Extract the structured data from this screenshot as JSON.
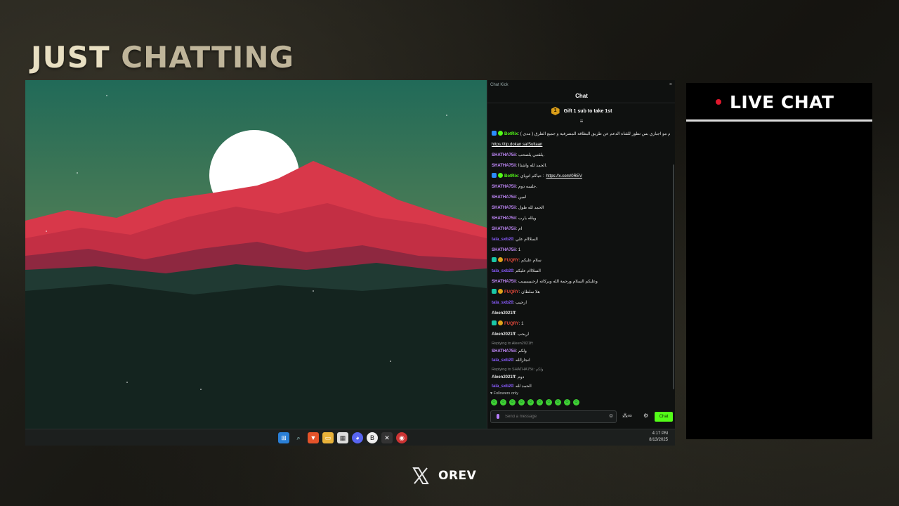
{
  "overlay": {
    "title_word1": "JUST",
    "title_word2": "CHATTING",
    "live_chat_label": "LIVE CHAT",
    "footer_name": "OREV",
    "footer_icon": "x-logo-icon"
  },
  "kick_window": {
    "window_title": "Chat Kick",
    "close_label": "×",
    "header": "Chat",
    "gift_badge": "1",
    "gift_text": "Gift 1 sub to take 1st",
    "followers_only": "Followers only",
    "input_placeholder": "Send a message",
    "chat_button": "Chat",
    "messages": [
      {
        "user": "BotRix",
        "text": "الدعم مو اجباري بس تطور للقناة الدعم عن طريق البطاقة المصرفية و جميع الطرق ( مدى ) :",
        "link": "https://tip.dokan.sa/Sultaan"
      },
      {
        "user": "SHATHA75ii",
        "text": "يلقتبي يلصحب."
      },
      {
        "user": "SHATHA75ii",
        "text": "الحمد لله واشتاا."
      },
      {
        "user": "BotRix",
        "text": "حياكم اتوياي :",
        "link": "https://x.com/0REV"
      },
      {
        "user": "SHATHA75ii",
        "text": "جلسه دوم."
      },
      {
        "user": "SHATHA75ii",
        "text": "امين"
      },
      {
        "user": "SHATHA75ii",
        "text": "الحمد لله طول"
      },
      {
        "user": "SHATHA75ii",
        "text": "ويلله يارب"
      },
      {
        "user": "SHATHA75ii",
        "text": "ام"
      },
      {
        "user": "tala_sxb20",
        "text": "السلااام علي"
      },
      {
        "user": "SHATHA75ii",
        "text": "1"
      },
      {
        "user": "FUQRY",
        "text": "سلام عليكم"
      },
      {
        "user": "tala_sxb20",
        "text": "السلااام عليكم"
      },
      {
        "user": "SHATHA75ii",
        "text": "وعليكم السلام ورحمة الله وبركاته ارحبيييييييب"
      },
      {
        "user": "FUQRY",
        "text": "هلا سلطان"
      },
      {
        "user": "tala_sxb20",
        "text": "ارحيب"
      },
      {
        "user": "Aleen2021ff",
        "text": ""
      },
      {
        "user": "FUQRY",
        "text": "1"
      },
      {
        "user": "Aleen2021ff",
        "text": "اريحب"
      },
      {
        "reply": "Replying to Aleen2021ff:",
        "user": "SHATHA75ii",
        "text": "ولكم"
      },
      {
        "user": "tala_sxb20",
        "text": "انجازالله"
      },
      {
        "reply": "Replying to SHATHA75ii: ولكم",
        "user": "Aleen2021ff",
        "text": "دوم"
      },
      {
        "user": "tala_sxb20",
        "text": "الحمد لله"
      }
    ]
  },
  "taskbar": {
    "time": "4:17 PM",
    "date": "8/13/2025",
    "icons": [
      "windows-icon",
      "search-icon",
      "brave-icon",
      "folder-icon",
      "calendar-icon",
      "discord-icon",
      "bold-icon",
      "xbox-icon",
      "chrome-icon"
    ]
  },
  "colors": {
    "kick_green": "#53fc18",
    "live_dot": "#e0182d",
    "title_cream": "#e8dfc2"
  }
}
